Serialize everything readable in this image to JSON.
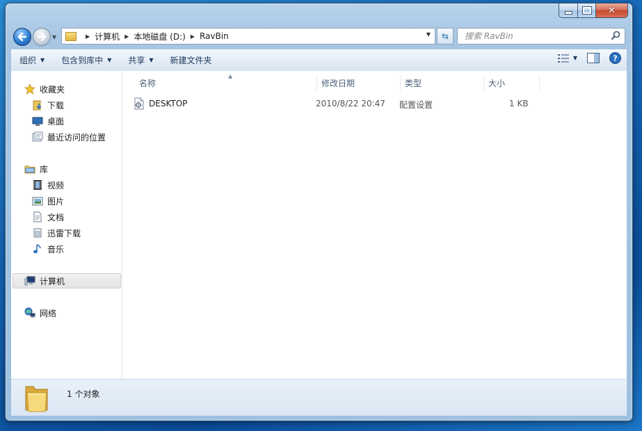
{
  "address": {
    "crumbs": [
      "计算机",
      "本地磁盘 (D:)",
      "RavBin"
    ]
  },
  "search": {
    "placeholder": "搜索 RavBin"
  },
  "toolbar": {
    "organize": "组织",
    "include_in_library": "包含到库中",
    "share": "共享",
    "new_folder": "新建文件夹"
  },
  "navigation": {
    "favorites": {
      "label": "收藏夹",
      "items": [
        "下载",
        "桌面",
        "最近访问的位置"
      ]
    },
    "libraries": {
      "label": "库",
      "items": [
        "视频",
        "图片",
        "文档",
        "迅雷下载",
        "音乐"
      ]
    },
    "computer": "计算机",
    "network": "网络"
  },
  "columns": {
    "name": "名称",
    "modified": "修改日期",
    "type": "类型",
    "size": "大小"
  },
  "files": [
    {
      "name": "DESKTOP",
      "modified": "2010/8/22 20:47",
      "type": "配置设置",
      "size": "1 KB",
      "icon": "settings-file-icon"
    }
  ],
  "status": {
    "count": "1 个对象"
  },
  "colors": {
    "desktop": "#1565b5",
    "chrome": "#a6c6e4",
    "close": "#c44a2f",
    "text_link": "#1e395b"
  }
}
